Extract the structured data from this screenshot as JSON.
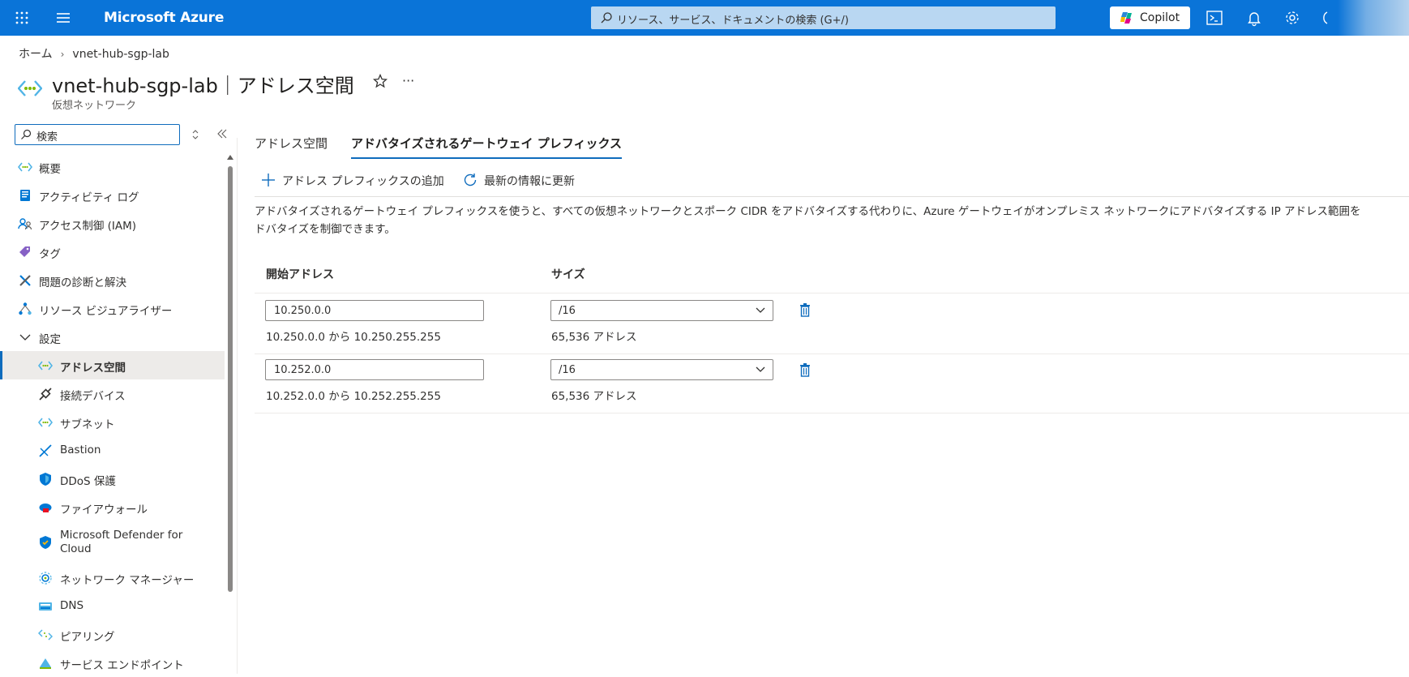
{
  "topbar": {
    "brand": "Microsoft Azure",
    "search_placeholder": "リソース、サービス、ドキュメントの検索 (G+/)",
    "copilot_label": "Copilot"
  },
  "breadcrumb": {
    "home": "ホーム",
    "current": "vnet-hub-sgp-lab"
  },
  "header": {
    "title": "vnet-hub-sgp-lab｜アドレス空間",
    "subtitle": "仮想ネットワーク"
  },
  "nav": {
    "search_placeholder": "検索",
    "items": [
      {
        "label": "概要",
        "icon": "vnet-icon"
      },
      {
        "label": "アクティビティ ログ",
        "icon": "activity-log-icon"
      },
      {
        "label": "アクセス制御 (IAM)",
        "icon": "iam-icon"
      },
      {
        "label": "タグ",
        "icon": "tag-icon"
      },
      {
        "label": "問題の診断と解決",
        "icon": "diagnose-icon"
      },
      {
        "label": "リソース ビジュアライザー",
        "icon": "visualizer-icon"
      },
      {
        "label": "設定",
        "icon": "chevron-down-icon"
      },
      {
        "label": "アドレス空間",
        "icon": "vnet-icon"
      },
      {
        "label": "接続デバイス",
        "icon": "plug-icon"
      },
      {
        "label": "サブネット",
        "icon": "vnet-icon"
      },
      {
        "label": "Bastion",
        "icon": "bastion-icon"
      },
      {
        "label": "DDoS 保護",
        "icon": "shield-icon"
      },
      {
        "label": "ファイアウォール",
        "icon": "firewall-icon"
      },
      {
        "label": "Microsoft Defender for Cloud",
        "icon": "defender-icon"
      },
      {
        "label": "ネットワーク マネージャー",
        "icon": "network-manager-icon"
      },
      {
        "label": "DNS",
        "icon": "dns-icon"
      },
      {
        "label": "ピアリング",
        "icon": "peering-icon"
      },
      {
        "label": "サービス エンドポイント",
        "icon": "service-endpoint-icon"
      }
    ]
  },
  "tabs": [
    {
      "label": "アドレス空間"
    },
    {
      "label": "アドバタイズされるゲートウェイ プレフィックス"
    }
  ],
  "commands": {
    "add": "アドレス プレフィックスの追加",
    "refresh": "最新の情報に更新"
  },
  "description": [
    "アドバタイズされるゲートウェイ プレフィックスを使うと、すべての仮想ネットワークとスポーク CIDR をアドバタイズする代わりに、Azure ゲートウェイがオンプレミス ネットワークにアドバタイズする IP アドレス範囲を",
    "ドバタイズを制御できます。"
  ],
  "table": {
    "headers": {
      "start": "開始アドレス",
      "size": "サイズ"
    },
    "rows": [
      {
        "start": "10.250.0.0",
        "range": "10.250.0.0 から 10.250.255.255",
        "size": "/16",
        "count": "65,536 アドレス"
      },
      {
        "start": "10.252.0.0",
        "range": "10.252.0.0 から 10.252.255.255",
        "size": "/16",
        "count": "65,536 アドレス"
      }
    ]
  },
  "colors": {
    "azure_blue": "#0a74d8",
    "accent": "#0f6cbd"
  }
}
